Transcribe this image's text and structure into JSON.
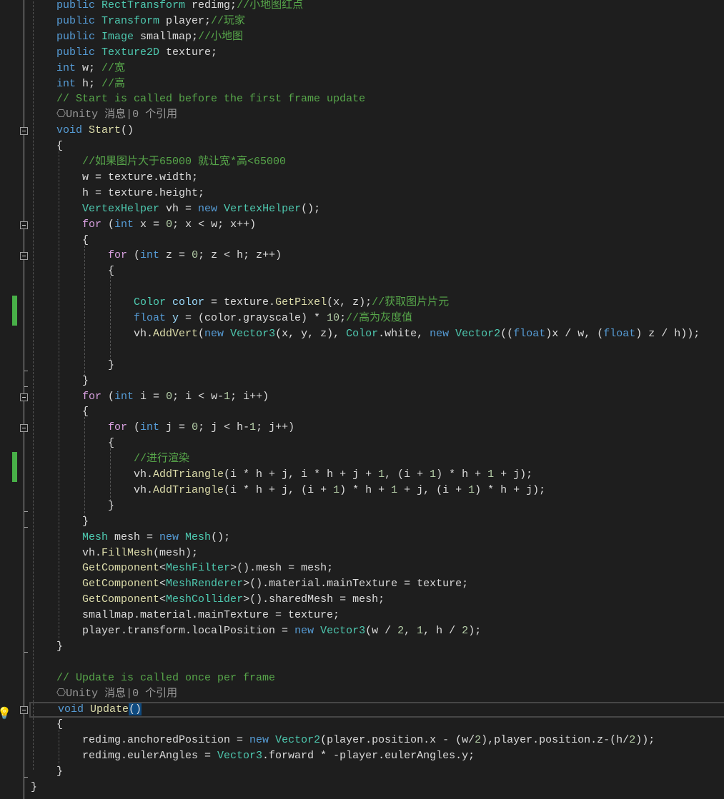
{
  "editor": {
    "lines": [
      {
        "indent": 2,
        "tokens": [
          [
            "kw",
            "public "
          ],
          [
            "type",
            "RectTransform"
          ],
          [
            "txt",
            " redimg;"
          ],
          [
            "cm",
            "//小地图红点"
          ]
        ]
      },
      {
        "indent": 2,
        "tokens": [
          [
            "kw",
            "public "
          ],
          [
            "type",
            "Transform"
          ],
          [
            "txt",
            " player;"
          ],
          [
            "cm",
            "//玩家"
          ]
        ]
      },
      {
        "indent": 2,
        "tokens": [
          [
            "kw",
            "public "
          ],
          [
            "type",
            "Image"
          ],
          [
            "txt",
            " smallmap;"
          ],
          [
            "cm",
            "//小地图"
          ]
        ]
      },
      {
        "indent": 2,
        "tokens": [
          [
            "kw",
            "public "
          ],
          [
            "type",
            "Texture2D"
          ],
          [
            "txt",
            " texture;"
          ]
        ]
      },
      {
        "indent": 2,
        "tokens": [
          [
            "kw",
            "int"
          ],
          [
            "txt",
            " w; "
          ],
          [
            "cm",
            "//宽"
          ]
        ]
      },
      {
        "indent": 2,
        "tokens": [
          [
            "kw",
            "int"
          ],
          [
            "txt",
            " h; "
          ],
          [
            "cm",
            "//高"
          ]
        ]
      },
      {
        "indent": 2,
        "tokens": [
          [
            "cm",
            "// Start is called before the first frame update"
          ]
        ]
      },
      {
        "indent": 2,
        "tokens": [
          [
            "lens",
            "⎔Unity 消息|0 个引用"
          ]
        ]
      },
      {
        "indent": 2,
        "tokens": [
          [
            "kw",
            "void "
          ],
          [
            "fn",
            "Start"
          ],
          [
            "txt",
            "()"
          ]
        ]
      },
      {
        "indent": 2,
        "tokens": [
          [
            "txt",
            "{"
          ]
        ]
      },
      {
        "indent": 3,
        "tokens": [
          [
            "cm",
            "//如果图片大于65000 就让宽*高<65000"
          ]
        ]
      },
      {
        "indent": 3,
        "tokens": [
          [
            "txt",
            "w = texture.width;"
          ]
        ]
      },
      {
        "indent": 3,
        "tokens": [
          [
            "txt",
            "h = texture.height;"
          ]
        ]
      },
      {
        "indent": 3,
        "tokens": [
          [
            "type",
            "VertexHelper"
          ],
          [
            "txt",
            " vh = "
          ],
          [
            "kw",
            "new "
          ],
          [
            "type",
            "VertexHelper"
          ],
          [
            "txt",
            "();"
          ]
        ]
      },
      {
        "indent": 3,
        "tokens": [
          [
            "ctl",
            "for"
          ],
          [
            "txt",
            " ("
          ],
          [
            "kw",
            "int"
          ],
          [
            "txt",
            " x = "
          ],
          [
            "num",
            "0"
          ],
          [
            "txt",
            "; x < w; x++)"
          ]
        ]
      },
      {
        "indent": 3,
        "tokens": [
          [
            "txt",
            "{"
          ]
        ]
      },
      {
        "indent": 4,
        "tokens": [
          [
            "ctl",
            "for"
          ],
          [
            "txt",
            " ("
          ],
          [
            "kw",
            "int"
          ],
          [
            "txt",
            " z = "
          ],
          [
            "num",
            "0"
          ],
          [
            "txt",
            "; z < h; z++)"
          ]
        ]
      },
      {
        "indent": 4,
        "tokens": [
          [
            "txt",
            "{"
          ]
        ]
      },
      {
        "indent": 5,
        "tokens": []
      },
      {
        "indent": 5,
        "tokens": [
          [
            "type",
            "Color"
          ],
          [
            "var",
            " color"
          ],
          [
            "txt",
            " = texture."
          ],
          [
            "fn",
            "GetPixel"
          ],
          [
            "txt",
            "(x, z);"
          ],
          [
            "cm",
            "//获取图片片元"
          ]
        ]
      },
      {
        "indent": 5,
        "tokens": [
          [
            "kw",
            "float"
          ],
          [
            "var",
            " y"
          ],
          [
            "txt",
            " = (color.grayscale) * "
          ],
          [
            "num",
            "10"
          ],
          [
            "txt",
            ";"
          ],
          [
            "cm",
            "//高为灰度值"
          ]
        ]
      },
      {
        "indent": 5,
        "tokens": [
          [
            "txt",
            "vh."
          ],
          [
            "fn",
            "AddVert"
          ],
          [
            "txt",
            "("
          ],
          [
            "kw",
            "new "
          ],
          [
            "type",
            "Vector3"
          ],
          [
            "txt",
            "(x, y, z), "
          ],
          [
            "type",
            "Color"
          ],
          [
            "txt",
            ".white, "
          ],
          [
            "kw",
            "new "
          ],
          [
            "type",
            "Vector2"
          ],
          [
            "txt",
            "(("
          ],
          [
            "kw",
            "float"
          ],
          [
            "txt",
            ")x / w, ("
          ],
          [
            "kw",
            "float"
          ],
          [
            "txt",
            ") z / h));"
          ]
        ]
      },
      {
        "indent": 5,
        "tokens": []
      },
      {
        "indent": 4,
        "tokens": [
          [
            "txt",
            "}"
          ]
        ]
      },
      {
        "indent": 3,
        "tokens": [
          [
            "txt",
            "}"
          ]
        ]
      },
      {
        "indent": 3,
        "tokens": [
          [
            "ctl",
            "for"
          ],
          [
            "txt",
            " ("
          ],
          [
            "kw",
            "int"
          ],
          [
            "txt",
            " i = "
          ],
          [
            "num",
            "0"
          ],
          [
            "txt",
            "; i < w-"
          ],
          [
            "num",
            "1"
          ],
          [
            "txt",
            "; i++)"
          ]
        ]
      },
      {
        "indent": 3,
        "tokens": [
          [
            "txt",
            "{"
          ]
        ]
      },
      {
        "indent": 4,
        "tokens": [
          [
            "ctl",
            "for"
          ],
          [
            "txt",
            " ("
          ],
          [
            "kw",
            "int"
          ],
          [
            "txt",
            " j = "
          ],
          [
            "num",
            "0"
          ],
          [
            "txt",
            "; j < h-"
          ],
          [
            "num",
            "1"
          ],
          [
            "txt",
            "; j++)"
          ]
        ]
      },
      {
        "indent": 4,
        "tokens": [
          [
            "txt",
            "{"
          ]
        ]
      },
      {
        "indent": 5,
        "tokens": [
          [
            "cm",
            "//进行渲染"
          ]
        ]
      },
      {
        "indent": 5,
        "tokens": [
          [
            "txt",
            "vh."
          ],
          [
            "fn",
            "AddTriangle"
          ],
          [
            "txt",
            "(i * h + j, i * h + j + "
          ],
          [
            "num",
            "1"
          ],
          [
            "txt",
            ", (i + "
          ],
          [
            "num",
            "1"
          ],
          [
            "txt",
            ") * h + "
          ],
          [
            "num",
            "1"
          ],
          [
            "txt",
            " + j);"
          ]
        ]
      },
      {
        "indent": 5,
        "tokens": [
          [
            "txt",
            "vh."
          ],
          [
            "fn",
            "AddTriangle"
          ],
          [
            "txt",
            "(i * h + j, (i + "
          ],
          [
            "num",
            "1"
          ],
          [
            "txt",
            ") * h + "
          ],
          [
            "num",
            "1"
          ],
          [
            "txt",
            " + j, (i + "
          ],
          [
            "num",
            "1"
          ],
          [
            "txt",
            ") * h + j);"
          ]
        ]
      },
      {
        "indent": 4,
        "tokens": [
          [
            "txt",
            "}"
          ]
        ]
      },
      {
        "indent": 3,
        "tokens": [
          [
            "txt",
            "}"
          ]
        ]
      },
      {
        "indent": 3,
        "tokens": [
          [
            "type",
            "Mesh"
          ],
          [
            "txt",
            " mesh = "
          ],
          [
            "kw",
            "new "
          ],
          [
            "type",
            "Mesh"
          ],
          [
            "txt",
            "();"
          ]
        ]
      },
      {
        "indent": 3,
        "tokens": [
          [
            "txt",
            "vh."
          ],
          [
            "fn",
            "FillMesh"
          ],
          [
            "txt",
            "(mesh);"
          ]
        ]
      },
      {
        "indent": 3,
        "tokens": [
          [
            "fn",
            "GetComponent"
          ],
          [
            "txt",
            "<"
          ],
          [
            "type",
            "MeshFilter"
          ],
          [
            "txt",
            ">().mesh = mesh;"
          ]
        ]
      },
      {
        "indent": 3,
        "tokens": [
          [
            "fn",
            "GetComponent"
          ],
          [
            "txt",
            "<"
          ],
          [
            "type",
            "MeshRenderer"
          ],
          [
            "txt",
            ">().material.mainTexture = texture;"
          ]
        ]
      },
      {
        "indent": 3,
        "tokens": [
          [
            "fn",
            "GetComponent"
          ],
          [
            "txt",
            "<"
          ],
          [
            "type",
            "MeshCollider"
          ],
          [
            "txt",
            ">().sharedMesh = mesh;"
          ]
        ]
      },
      {
        "indent": 3,
        "tokens": [
          [
            "txt",
            "smallmap.material.mainTexture = texture;"
          ]
        ]
      },
      {
        "indent": 3,
        "tokens": [
          [
            "txt",
            "player.transform.localPosition = "
          ],
          [
            "kw",
            "new "
          ],
          [
            "type",
            "Vector3"
          ],
          [
            "txt",
            "(w / "
          ],
          [
            "num",
            "2"
          ],
          [
            "txt",
            ", "
          ],
          [
            "num",
            "1"
          ],
          [
            "txt",
            ", h / "
          ],
          [
            "num",
            "2"
          ],
          [
            "txt",
            ");"
          ]
        ]
      },
      {
        "indent": 2,
        "tokens": [
          [
            "txt",
            "}"
          ]
        ]
      },
      {
        "indent": 2,
        "tokens": []
      },
      {
        "indent": 2,
        "tokens": [
          [
            "cm",
            "// Update is called once per frame"
          ]
        ]
      },
      {
        "indent": 2,
        "tokens": [
          [
            "lens",
            "⎔Unity 消息|0 个引用"
          ]
        ]
      },
      {
        "indent": 2,
        "current": true,
        "tokens": [
          [
            "kw",
            "void "
          ],
          [
            "fn",
            "Update"
          ],
          [
            "paren-hl",
            "()"
          ]
        ]
      },
      {
        "indent": 2,
        "tokens": [
          [
            "txt",
            "{"
          ]
        ]
      },
      {
        "indent": 3,
        "tokens": [
          [
            "txt",
            "redimg.anchoredPosition = "
          ],
          [
            "kw",
            "new "
          ],
          [
            "type",
            "Vector2"
          ],
          [
            "txt",
            "(player.position.x - (w/"
          ],
          [
            "num",
            "2"
          ],
          [
            "txt",
            "),player.position.z-(h/"
          ],
          [
            "num",
            "2"
          ],
          [
            "txt",
            "));"
          ]
        ]
      },
      {
        "indent": 3,
        "tokens": [
          [
            "txt",
            "redimg.eulerAngles = "
          ],
          [
            "type",
            "Vector3"
          ],
          [
            "txt",
            ".forward * -player.eulerAngles.y;"
          ]
        ]
      },
      {
        "indent": 2,
        "tokens": [
          [
            "txt",
            "}"
          ]
        ]
      },
      {
        "indent": 0,
        "tokens": [
          [
            "txt",
            "}"
          ]
        ]
      }
    ],
    "colors": {
      "background": "#1e1e1e",
      "change_bar": "#48b048",
      "current_line_border": "#464646"
    }
  }
}
